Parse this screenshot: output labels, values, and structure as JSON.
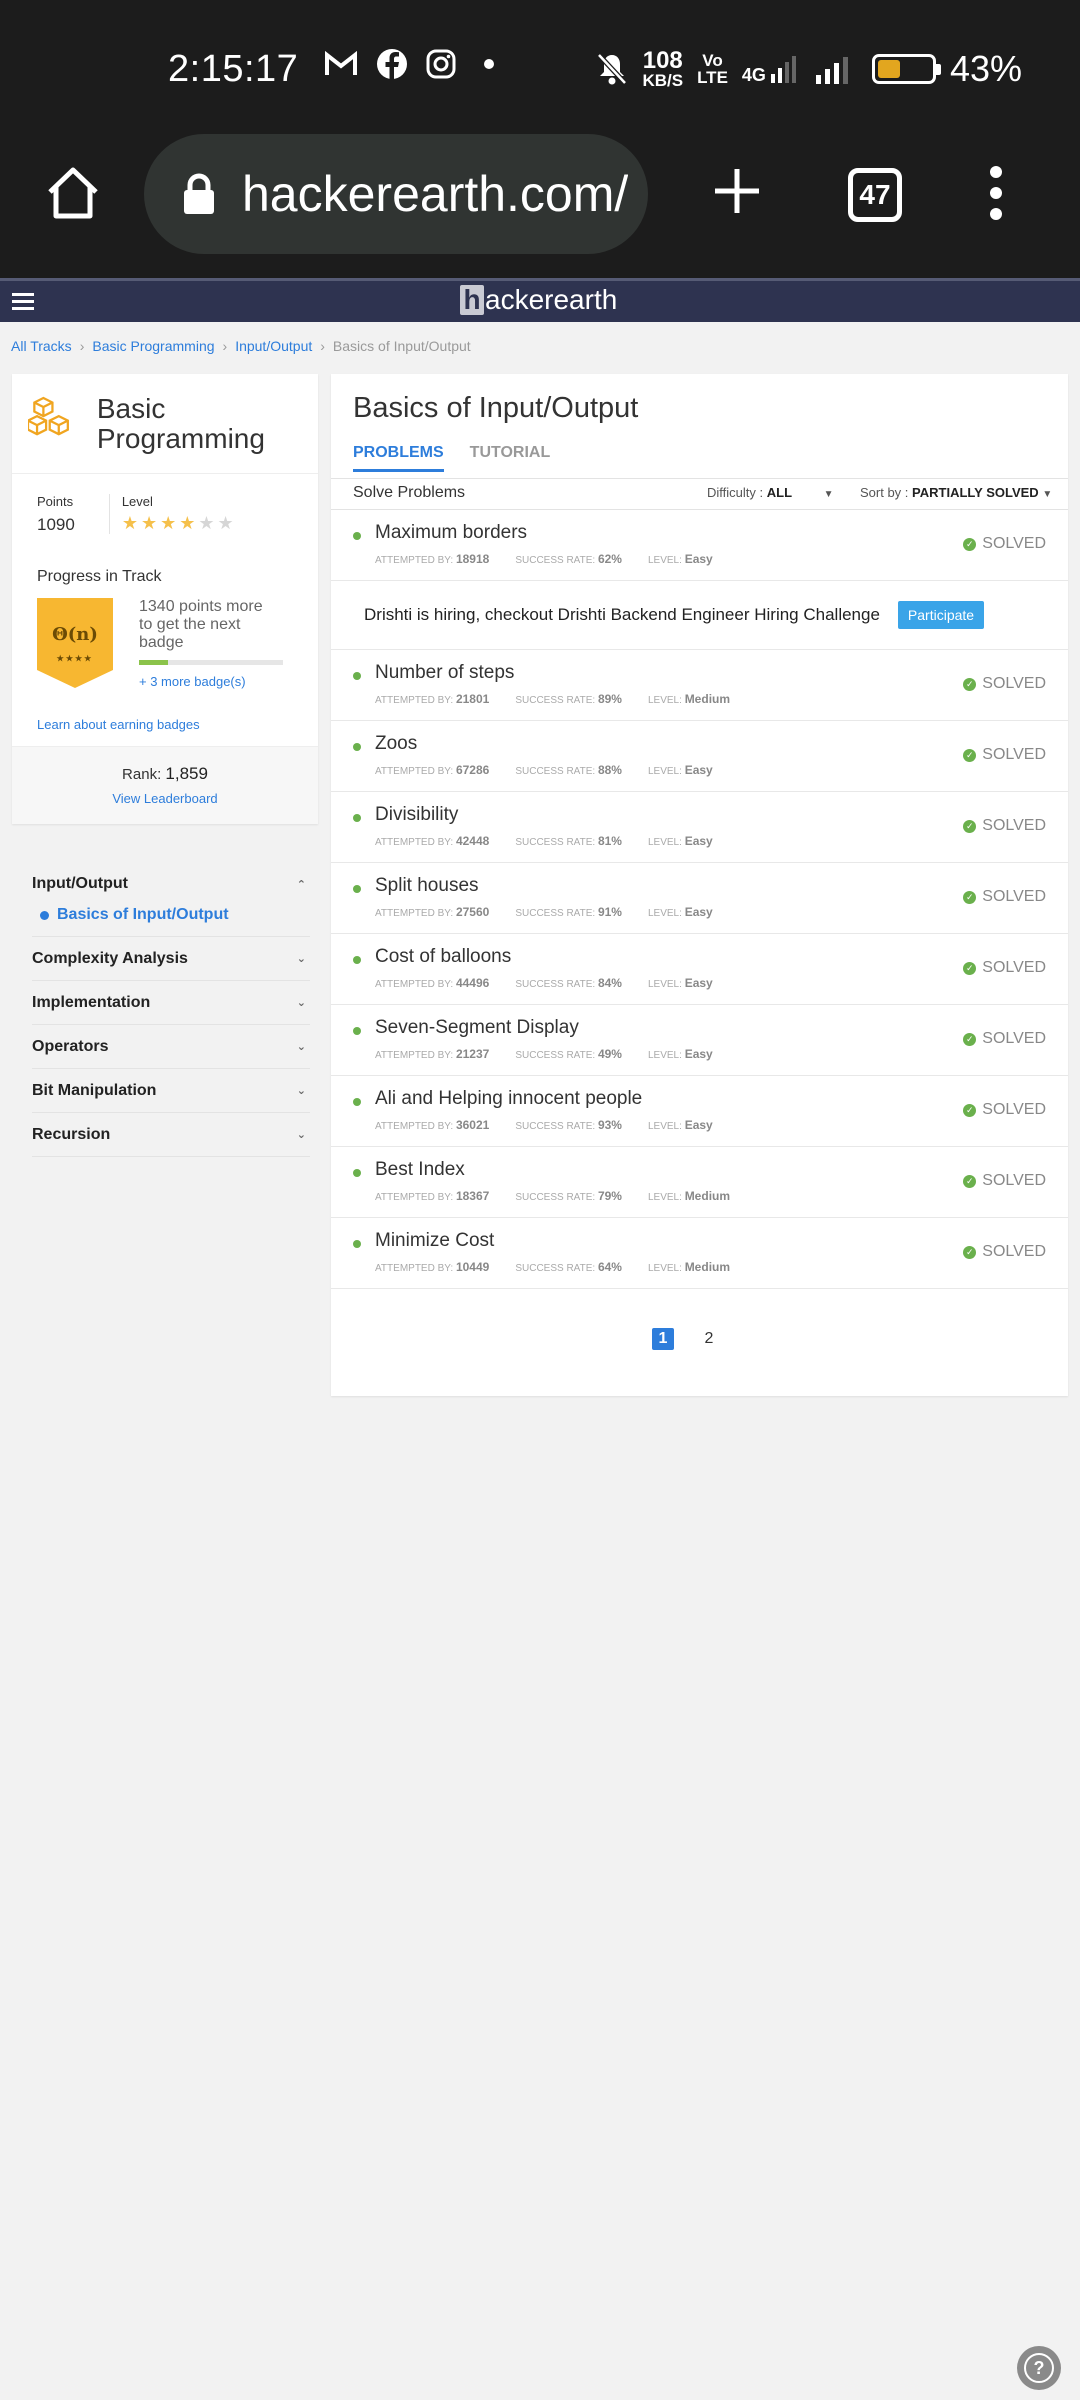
{
  "status_bar": {
    "time": "2:15:17",
    "net_speed_value": "108",
    "net_speed_unit": "KB/S",
    "volte_top": "Vo",
    "volte_bottom": "LTE",
    "network": "4G",
    "battery_percent": "43%",
    "battery_level": 0.43,
    "icons": [
      "gmail-icon",
      "facebook-icon",
      "instagram-icon",
      "dot-icon",
      "mute-icon",
      "signal-icon",
      "battery-icon"
    ]
  },
  "browser": {
    "url": "hackerearth.com/",
    "tab_count": "47"
  },
  "site": {
    "logo_letter": "h",
    "logo_rest": "ackerearth"
  },
  "breadcrumb": [
    "All Tracks",
    "Basic Programming",
    "Input/Output",
    "Basics of Input/Output"
  ],
  "track": {
    "title": "Basic Programming",
    "points_label": "Points",
    "points": "1090",
    "level_label": "Level",
    "level_stars": 4,
    "progress_label": "Progress in Track",
    "badge_text": "Θ(n)",
    "badge_stars": "★★★★",
    "next_badge_text": "1340 points more to get the next badge",
    "next_badge_progress": 0.2,
    "more_badges": "+ 3 more badge(s)",
    "learn_link": "Learn about earning badges",
    "rank_label": "Rank:",
    "rank": "1,859",
    "leaderboard_link": "View Leaderboard"
  },
  "topics": {
    "open": {
      "label": "Input/Output",
      "sub": "Basics of Input/Output"
    },
    "items": [
      "Complexity Analysis",
      "Implementation",
      "Operators",
      "Bit Manipulation",
      "Recursion"
    ]
  },
  "main": {
    "title": "Basics of Input/Output",
    "tabs": [
      "PROBLEMS",
      "TUTORIAL"
    ],
    "solve_label": "Solve Problems",
    "difficulty_label": "Difficulty :",
    "difficulty_value": "ALL",
    "sort_label": "Sort by :",
    "sort_value": "PARTIALLY SOLVED",
    "meta_labels": {
      "attempted": "ATTEMPTED BY:",
      "success": "SUCCESS RATE:",
      "level": "LEVEL:"
    },
    "solved_label": "SOLVED",
    "hiring_text": "Drishti is hiring, checkout Drishti Backend Engineer Hiring Challenge",
    "participate_label": "Participate",
    "problems": [
      {
        "name": "Maximum borders",
        "attempted": "18918",
        "success": "62%",
        "level": "Easy"
      },
      {
        "name": "Number of steps",
        "attempted": "21801",
        "success": "89%",
        "level": "Medium"
      },
      {
        "name": "Zoos",
        "attempted": "67286",
        "success": "88%",
        "level": "Easy"
      },
      {
        "name": "Divisibility",
        "attempted": "42448",
        "success": "81%",
        "level": "Easy"
      },
      {
        "name": "Split houses",
        "attempted": "27560",
        "success": "91%",
        "level": "Easy"
      },
      {
        "name": "Cost of balloons",
        "attempted": "44496",
        "success": "84%",
        "level": "Easy"
      },
      {
        "name": "Seven-Segment Display",
        "attempted": "21237",
        "success": "49%",
        "level": "Easy"
      },
      {
        "name": "Ali and Helping innocent people",
        "attempted": "36021",
        "success": "93%",
        "level": "Easy"
      },
      {
        "name": "Best Index",
        "attempted": "18367",
        "success": "79%",
        "level": "Medium"
      },
      {
        "name": "Minimize Cost",
        "attempted": "10449",
        "success": "64%",
        "level": "Medium"
      }
    ],
    "pages": [
      "1",
      "2"
    ]
  },
  "help_label": "?"
}
